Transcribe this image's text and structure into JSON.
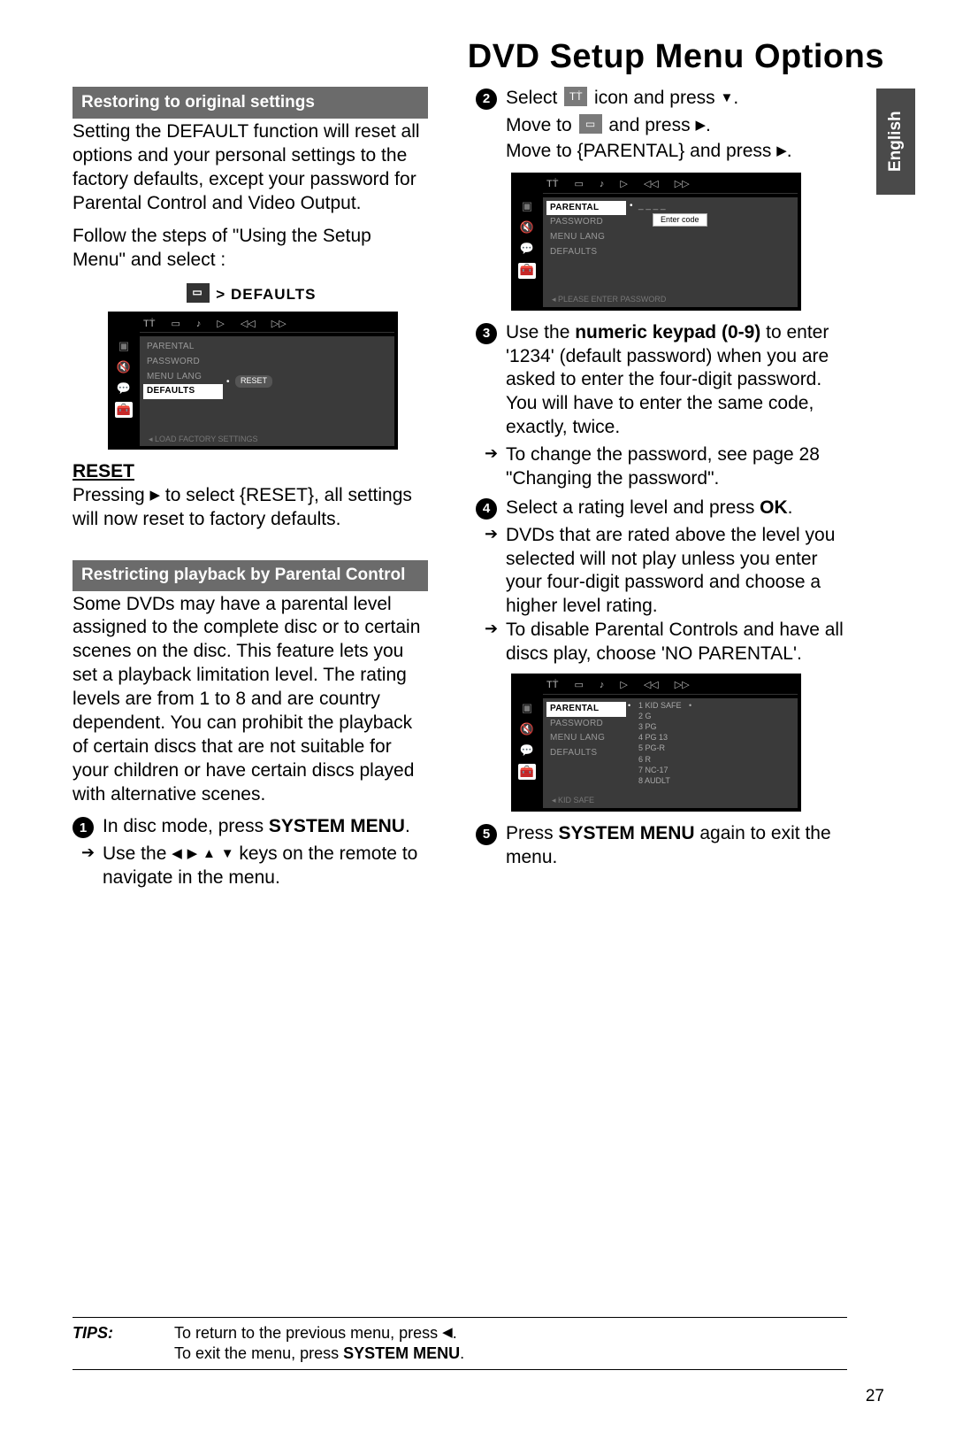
{
  "page_title": "DVD Setup Menu Options",
  "language_tab": "English",
  "page_number": "27",
  "left": {
    "section1_heading": "Restoring to original settings",
    "section1_p1": "Setting the DEFAULT function will reset all options and your personal settings to the factory defaults, except your password for Parental Control and Video Output.",
    "section1_p2": "Follow the steps of \"Using the Setup Menu\" and select :",
    "defaults_label_prefix": "> ",
    "defaults_label": "DEFAULTS",
    "reset_heading": "RESET",
    "reset_text_a": "Pressing ",
    "reset_text_b": " to select {RESET}, all settings will now reset to factory defaults.",
    "section2_heading": "Restricting playback by Parental Control",
    "section2_p": "Some DVDs may have a parental level assigned to the complete disc or to certain scenes on the disc. This feature lets you set a playback limitation level. The rating levels are from 1 to 8 and are country dependent. You can prohibit the playback of certain discs that are not suitable for your children or have certain discs played with alternative scenes.",
    "step1_a": "In disc mode, press ",
    "step1_b": "SYSTEM MENU",
    "step1_c": ".",
    "step1_sub_a": "Use the ",
    "step1_sub_b": " keys on the remote to navigate in the menu."
  },
  "right": {
    "step2_a": "Select ",
    "step2_b": " icon and press ",
    "step2_c": ".",
    "step2_l2a": "Move to ",
    "step2_l2b": " and press ",
    "step2_l2c": ".",
    "step2_l3a": "Move to {PARENTAL} and press ",
    "step2_l3b": ".",
    "step3_a": "Use the ",
    "step3_b": "numeric keypad (0-9)",
    "step3_c": " to enter '1234' (default password) when you are asked to enter the four-digit password. You will have to enter the same code, exactly, twice.",
    "step3_sub": "To change the password, see page 28 \"Changing the password\".",
    "step4_a": "Select a rating level and press ",
    "step4_b": "OK",
    "step4_c": ".",
    "step4_sub1": "DVDs that are rated above the level you selected will not play unless you enter your four-digit password and choose a higher level rating.",
    "step4_sub2": "To disable Parental Controls and have all discs play, choose 'NO PARENTAL'.",
    "step5_a": "Press ",
    "step5_b": "SYSTEM MENU",
    "step5_c": " again to exit the menu."
  },
  "osd_menu_items": [
    "PARENTAL",
    "PASSWORD",
    "MENU LANG",
    "DEFAULTS"
  ],
  "osd1": {
    "highlight": "DEFAULTS",
    "pill": "RESET",
    "footer": "LOAD FACTORY SETTINGS"
  },
  "osd2": {
    "highlight": "PARENTAL",
    "entercode": "Enter code",
    "footer": "PLEASE ENTER PASSWORD"
  },
  "osd3": {
    "highlight": "PARENTAL",
    "ratings": [
      "1 KID SAFE",
      "2 G",
      "3 PG",
      "4 PG 13",
      "5 PG-R",
      "6 R",
      "7 NC-17",
      "8 AUDLT"
    ],
    "footer": "KID SAFE"
  },
  "tips": {
    "label": "TIPS:",
    "line1_a": "To return to the previous menu, press ",
    "line1_b": ".",
    "line2_a": "To exit the menu, press ",
    "line2_b": "SYSTEM MENU",
    "line2_c": "."
  }
}
